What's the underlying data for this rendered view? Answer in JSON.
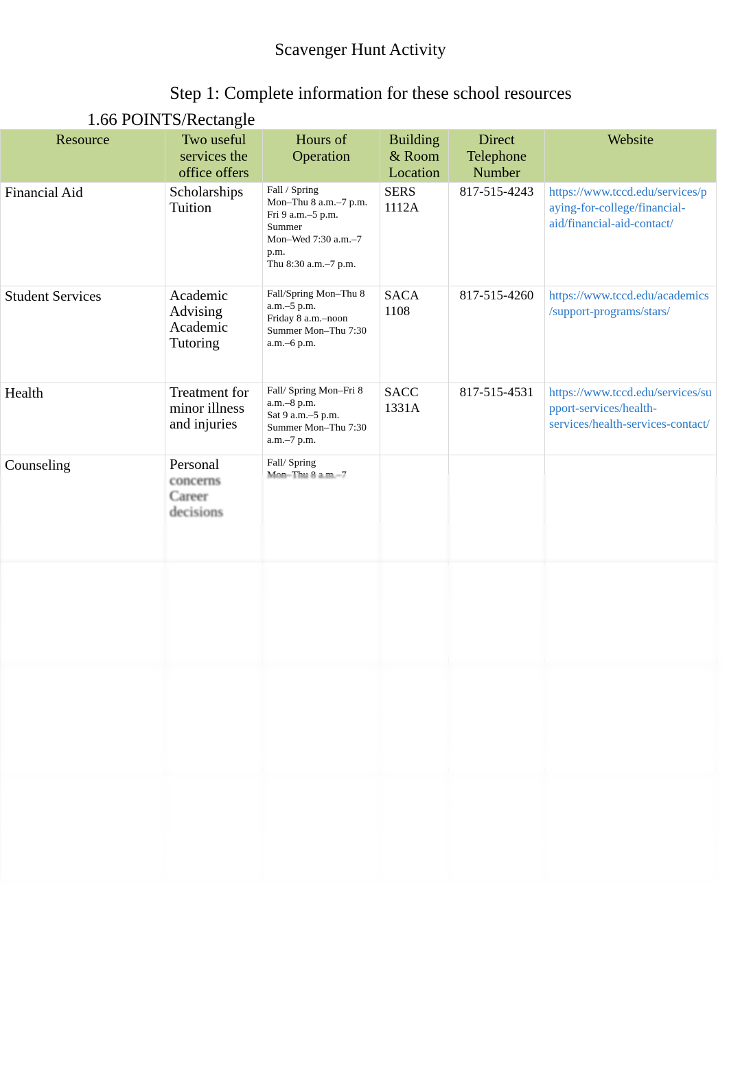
{
  "document": {
    "title": "Scavenger Hunt Activity",
    "step_instruction": "Step 1:  Complete information for these school resources",
    "points_note": "1.66 POINTS/Rectangle"
  },
  "colors": {
    "header_green": "#c4d695",
    "link_blue": "#2374c9",
    "grid_line": "#d9d9d9",
    "page_background": "#ffffff",
    "text": "#000000"
  },
  "table": {
    "columns": [
      {
        "key": "resource",
        "label": "Resource"
      },
      {
        "key": "services",
        "label": "Two useful services the office offers"
      },
      {
        "key": "hours",
        "label": "Hours of Operation"
      },
      {
        "key": "building",
        "label": "Building & Room Location"
      },
      {
        "key": "phone",
        "label": "Direct Telephone Number"
      },
      {
        "key": "website",
        "label": "Website"
      }
    ],
    "rows": [
      {
        "resource": "Financial Aid",
        "services": "Scholarships\nTuition",
        "hours": "Fall / Spring\nMon–Thu 8 a.m.–7 p.m.\nFri 9 a.m.–5 p.m.\nSummer\nMon–Wed 7:30 a.m.–7 p.m.\nThu 8:30 a.m.–7 p.m.",
        "building": "SERS 1112A",
        "phone": "817-515-4243",
        "website": "https://www.tccd.edu/services/paying-for-college/financial-aid/financial-aid-contact/",
        "legible": true
      },
      {
        "resource": "Student Services",
        "services": "Academic Advising\nAcademic Tutoring",
        "hours": "Fall/Spring Mon–Thu  8 a.m.–5 p.m.\nFriday 8 a.m.–noon\nSummer Mon–Thu 7:30 a.m.–6 p.m.",
        "building": "SACA 1108",
        "phone": "817-515-4260",
        "website": "https://www.tccd.edu/academics/support-programs/stars/",
        "legible": true
      },
      {
        "resource": "Health",
        "services": "Treatment for minor illness and injuries",
        "hours": "Fall/ Spring Mon–Fri 8 a.m.–8 p.m.\nSat 9 a.m.–5 p.m.\nSummer Mon–Thu 7:30 a.m.–7 p.m.",
        "building": "SACC 1331A",
        "phone": "817-515-4531",
        "website": "https://www.tccd.edu/services/support-services/health-services/health-services-contact/",
        "legible": true
      },
      {
        "resource": "Counseling",
        "services": "Personal concerns\nCareer decisions",
        "hours": "Fall/ Spring\nMon–Thu 8 a.m.–7",
        "building": "",
        "phone": "",
        "website": "",
        "legible": true
      },
      {
        "resource": "",
        "services": "",
        "hours": "",
        "building": "",
        "phone": "",
        "website": "",
        "legible": false
      },
      {
        "resource": "",
        "services": "",
        "hours": "",
        "building": "",
        "phone": "",
        "website": "",
        "legible": false
      },
      {
        "resource": "",
        "services": "",
        "hours": "",
        "building": "",
        "phone": "",
        "website": "",
        "legible": false
      }
    ]
  }
}
